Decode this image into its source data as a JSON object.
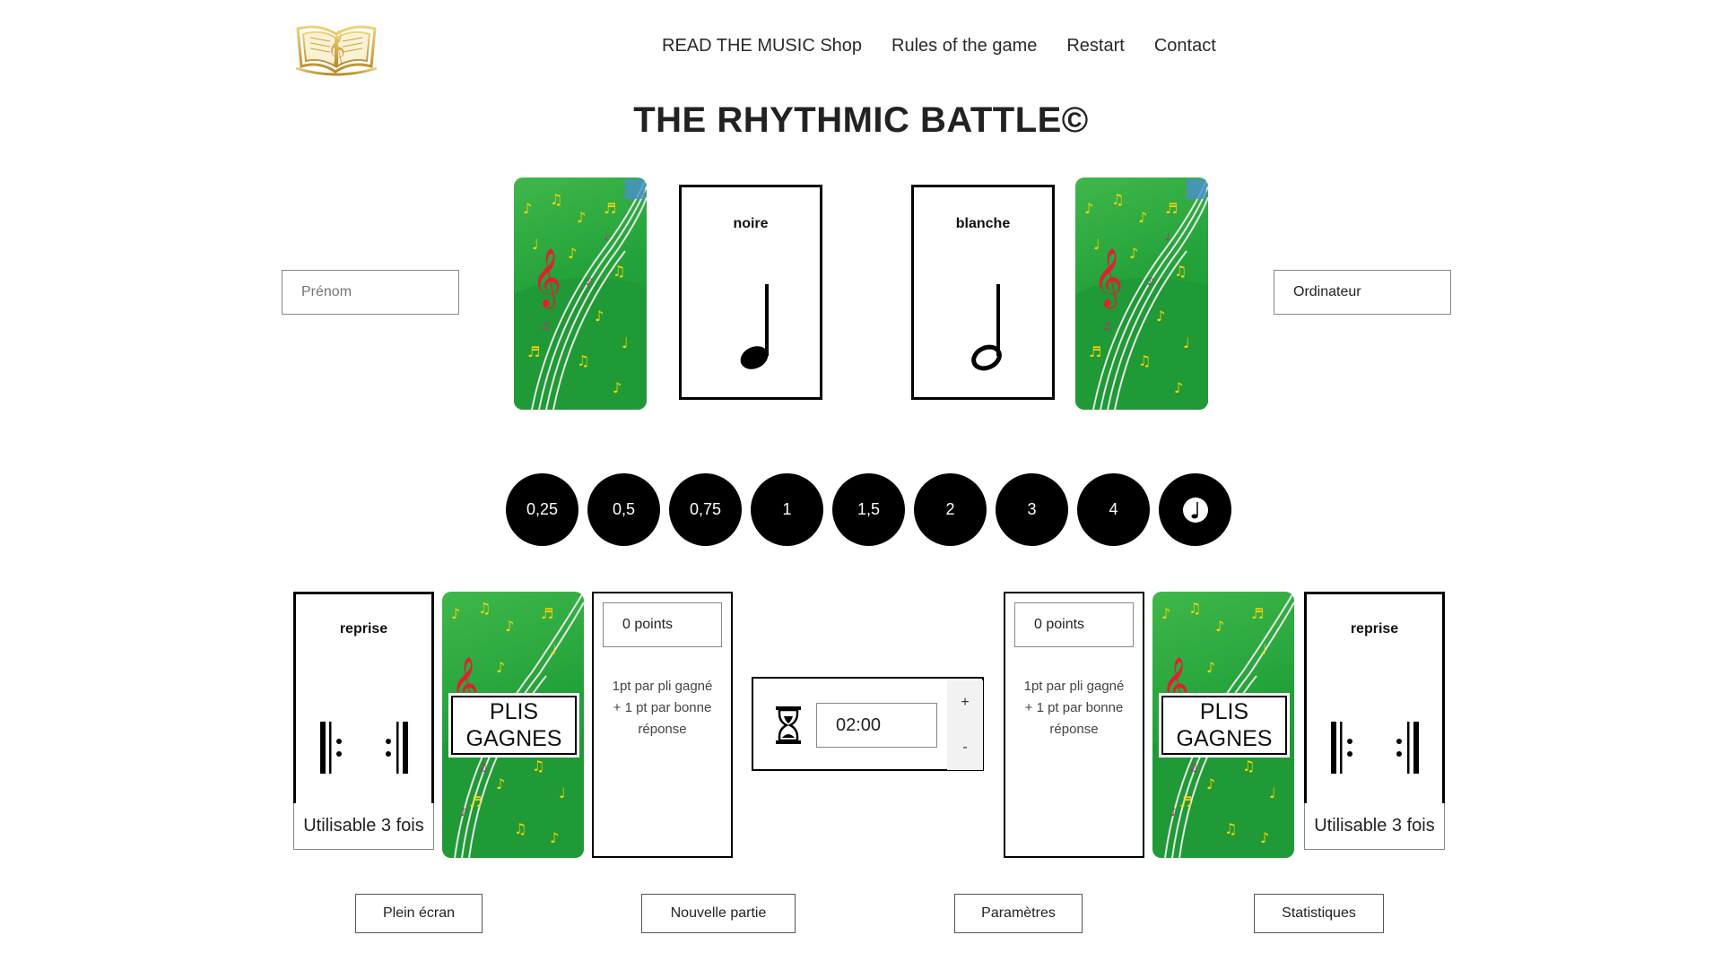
{
  "nav": {
    "items": [
      "READ THE MUSIC Shop",
      "Rules of the game",
      "Restart",
      "Contact"
    ]
  },
  "title": "THE RHYTHMIC BATTLE©",
  "player": {
    "name_placeholder": "Prénom",
    "score_value": "0 points",
    "score_rule": [
      "1pt par pli gagné",
      "+ 1 pt par bonne",
      "réponse"
    ],
    "tricks_label": [
      "PLIS",
      "GAGNES"
    ],
    "special_card": {
      "label": "reprise",
      "usable_text": "Utilisable 3 fois"
    }
  },
  "computer": {
    "name_value": "Ordinateur",
    "score_value": "0 points",
    "score_rule": [
      "1pt par pli gagné",
      "+ 1 pt par bonne",
      "réponse"
    ],
    "tricks_label": [
      "PLIS",
      "GAGNES"
    ],
    "special_card": {
      "label": "reprise",
      "usable_text": "Utilisable 3 fois"
    }
  },
  "played_cards": {
    "left": {
      "label": "noire",
      "symbol": "quarter-note-icon"
    },
    "right": {
      "label": "blanche",
      "symbol": "half-note-icon"
    }
  },
  "value_buttons": [
    "0,25",
    "0,5",
    "0,75",
    "1",
    "1,5",
    "2",
    "3",
    "4"
  ],
  "value_button_extra": "dotted-note-icon",
  "timer": {
    "value": "02:00",
    "increment": "+",
    "decrement": "-"
  },
  "buttons": {
    "fullscreen": "Plein écran",
    "new_game": "Nouvelle partie",
    "settings": "Paramètres",
    "statistics": "Statistiques"
  },
  "colors": {
    "card_green": "#2aa83d",
    "button_black": "#000000",
    "logo_gold": "#c9a23a"
  }
}
